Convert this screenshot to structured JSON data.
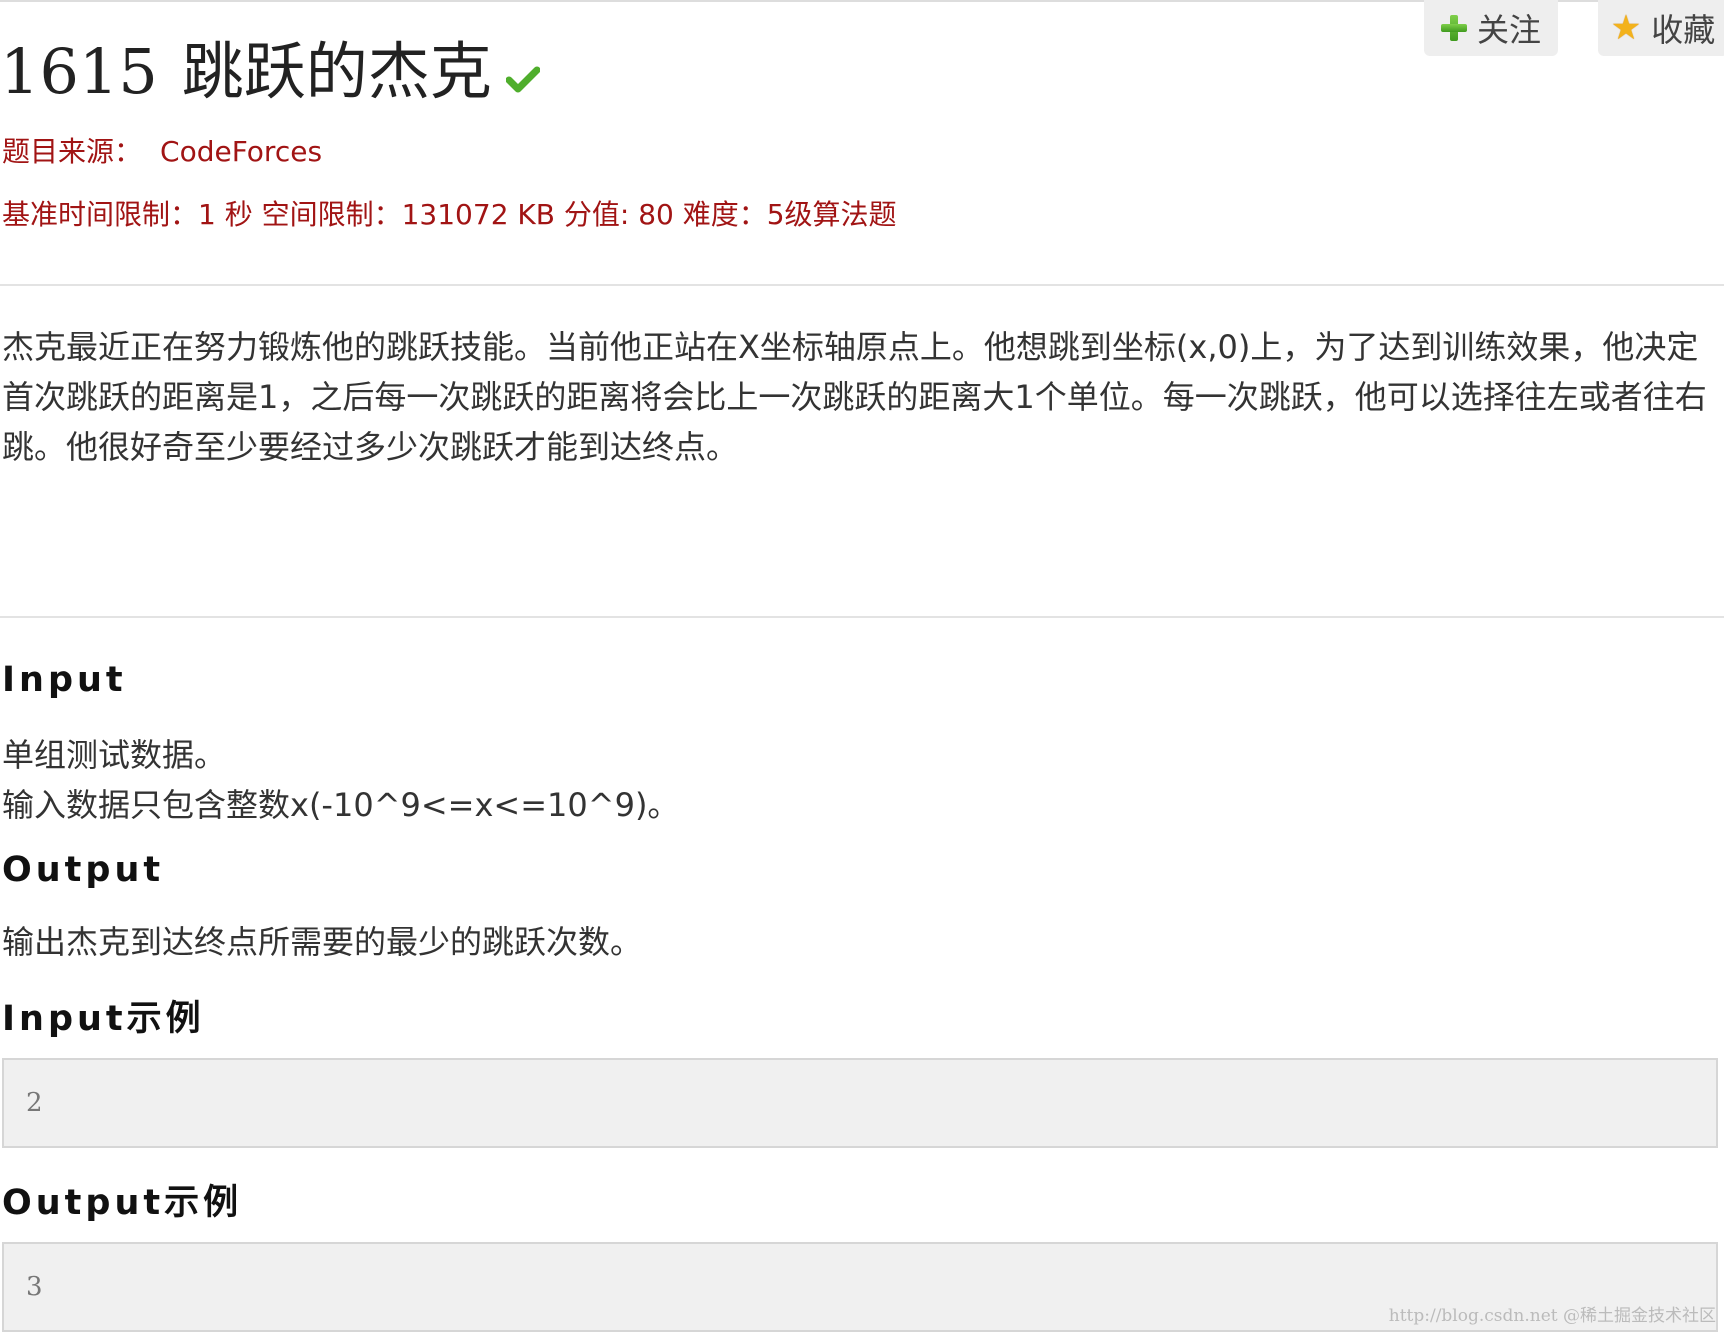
{
  "actions": {
    "follow_label": "关注",
    "favorite_label": "收藏"
  },
  "problem": {
    "id": "1615",
    "title": "跳跃的杰克",
    "solved_icon": "check-icon"
  },
  "source": {
    "label": "题目来源：",
    "value": "CodeForces"
  },
  "limits": "基准时间限制：1 秒 空间限制：131072 KB 分值: 80 难度：5级算法题",
  "description": "杰克最近正在努力锻炼他的跳跃技能。当前他正站在X坐标轴原点上。他想跳到坐标(x,0)上，为了达到训练效果，他决定首次跳跃的距离是1，之后每一次跳跃的距离将会比上一次跳跃的距离大1个单位。每一次跳跃，他可以选择往左或者往右跳。他很好奇至少要经过多少次跳跃才能到达终点。",
  "input_section": {
    "heading": "Input",
    "line1": "单组测试数据。",
    "line2": "输入数据只包含整数x(-10^9<=x<=10^9)。"
  },
  "output_section": {
    "heading": "Output",
    "text": "输出杰克到达终点所需要的最少的跳跃次数。"
  },
  "sample_input": {
    "heading": "Input示例",
    "value": "2"
  },
  "sample_output": {
    "heading": "Output示例",
    "value": "3"
  },
  "watermark": "http://blog.csdn.net @稀土掘金技术社区",
  "colors": {
    "meta_red": "#a11414",
    "check_green": "#4fae2c",
    "star_gold": "#f3b21b"
  }
}
